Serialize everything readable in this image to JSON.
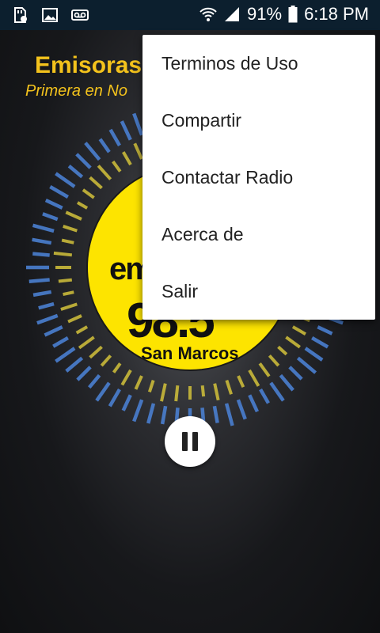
{
  "status_bar": {
    "left_icons": [
      "sd-card-icon",
      "image-icon",
      "voicemail-icon"
    ],
    "battery_text": "91%",
    "time": "6:18 PM"
  },
  "header": {
    "title": "Emisoras U",
    "subtitle": "Primera en No"
  },
  "logo": {
    "brand": "em",
    "frequency": "98.5",
    "city": "San Marcos"
  },
  "player": {
    "state_icon": "pause-icon"
  },
  "menu": {
    "items": [
      {
        "label": "Terminos de Uso"
      },
      {
        "label": "Compartir"
      },
      {
        "label": "Contactar Radio"
      },
      {
        "label": "Acerca de"
      },
      {
        "label": "Salir"
      }
    ]
  },
  "colors": {
    "status_bar_bg": "#0c1f2e",
    "accent_yellow": "#f3c21c",
    "logo_yellow": "#fde400",
    "dash_blue": "#4a7fd0",
    "dash_yellow": "#c9b93a"
  }
}
